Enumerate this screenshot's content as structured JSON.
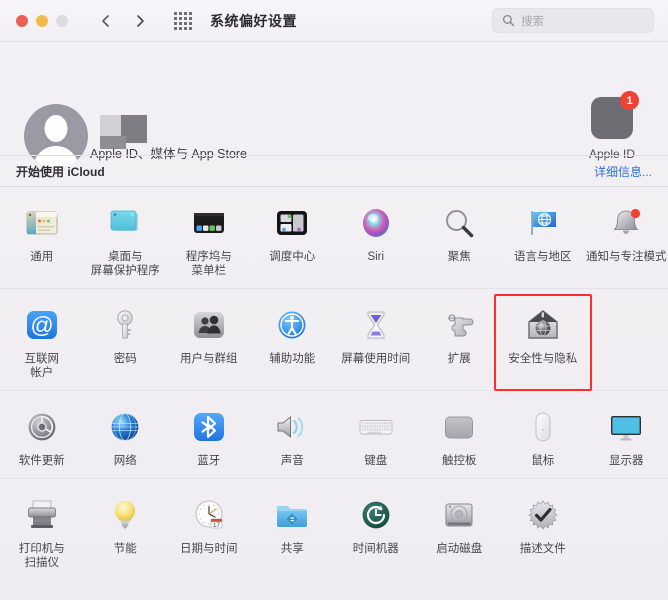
{
  "window": {
    "title": "系统偏好设置",
    "traffic_lights": [
      "close",
      "minimize",
      "zoom"
    ],
    "nav_back": "back-chevron",
    "nav_forward": "forward-chevron",
    "grid_button": "show-all-grid-icon"
  },
  "search": {
    "placeholder": "搜索",
    "value": "",
    "icon": "search-icon"
  },
  "header": {
    "avatar": "user-avatar",
    "account_name_redacted": true,
    "subtitle": "Apple ID、媒体与 App Store",
    "appleid_tile": {
      "label": "Apple ID",
      "badge": "1",
      "icon": "apple-logo-icon"
    }
  },
  "icloud_bar": {
    "label": "开始使用 iCloud",
    "link": "详细信息..."
  },
  "highlight": {
    "target": "安全性与隐私",
    "color": "#ff2d2d"
  },
  "sections": [
    {
      "name": "personal",
      "items": [
        {
          "label": "通用",
          "icon": "general-window-icon"
        },
        {
          "label": "桌面与\n屏幕保护程序",
          "icon": "desktop-screensaver-icon"
        },
        {
          "label": "程序坞与\n菜单栏",
          "icon": "dock-menubar-icon"
        },
        {
          "label": "调度中心",
          "icon": "mission-control-icon"
        },
        {
          "label": "Siri",
          "icon": "siri-orb-icon"
        },
        {
          "label": "聚焦",
          "icon": "spotlight-magnifier-icon"
        },
        {
          "label": "语言与地区",
          "icon": "language-region-flag-icon"
        },
        {
          "label": "通知与专注模式",
          "icon": "notifications-bell-icon"
        }
      ]
    },
    {
      "name": "accounts",
      "items": [
        {
          "label": "互联网\n帐户",
          "icon": "internet-accounts-at-icon"
        },
        {
          "label": "密码",
          "icon": "passwords-key-icon"
        },
        {
          "label": "用户与群组",
          "icon": "users-groups-icon"
        },
        {
          "label": "辅助功能",
          "icon": "accessibility-icon"
        },
        {
          "label": "屏幕使用时间",
          "icon": "screen-time-hourglass-icon"
        },
        {
          "label": "扩展",
          "icon": "extensions-puzzle-icon"
        },
        {
          "label": "安全性与隐私",
          "icon": "security-privacy-house-icon"
        }
      ]
    },
    {
      "name": "hardware",
      "items": [
        {
          "label": "软件更新",
          "icon": "software-update-gear-icon"
        },
        {
          "label": "网络",
          "icon": "network-globe-icon"
        },
        {
          "label": "蓝牙",
          "icon": "bluetooth-icon"
        },
        {
          "label": "声音",
          "icon": "sound-speaker-icon"
        },
        {
          "label": "键盘",
          "icon": "keyboard-icon"
        },
        {
          "label": "触控板",
          "icon": "trackpad-icon"
        },
        {
          "label": "鼠标",
          "icon": "mouse-icon"
        },
        {
          "label": "显示器",
          "icon": "displays-monitor-icon"
        }
      ]
    },
    {
      "name": "system",
      "items": [
        {
          "label": "打印机与\n扫描仪",
          "icon": "printers-scanners-icon"
        },
        {
          "label": "节能",
          "icon": "energy-saver-bulb-icon"
        },
        {
          "label": "日期与时间",
          "icon": "date-time-clock-icon"
        },
        {
          "label": "共享",
          "icon": "sharing-folder-icon"
        },
        {
          "label": "时间机器",
          "icon": "time-machine-icon"
        },
        {
          "label": "启动磁盘",
          "icon": "startup-disk-icon"
        },
        {
          "label": "描述文件",
          "icon": "profiles-badge-icon"
        }
      ]
    }
  ]
}
